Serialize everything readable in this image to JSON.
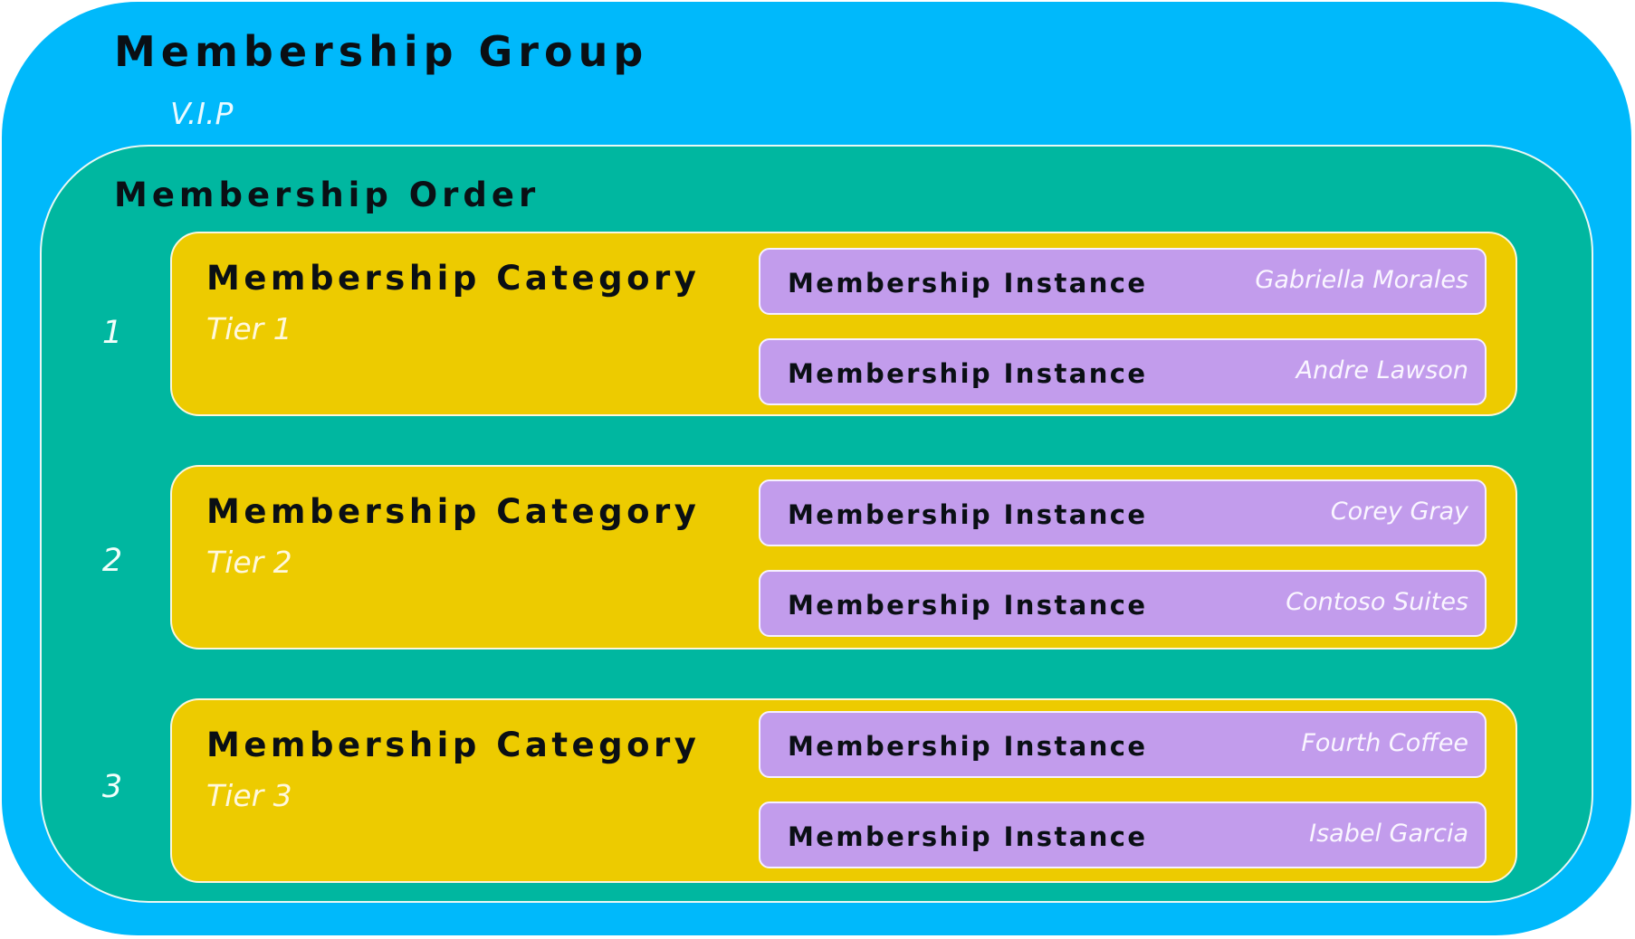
{
  "group": {
    "title": "Membership Group",
    "subtitle": "V.I.P"
  },
  "order": {
    "title": "Membership Order",
    "categories": [
      {
        "number": "1",
        "title": "Membership Category",
        "tier": "Tier 1",
        "instances": [
          {
            "title": "Membership Instance",
            "name": "Gabriella Morales"
          },
          {
            "title": "Membership Instance",
            "name": "Andre Lawson"
          }
        ]
      },
      {
        "number": "2",
        "title": "Membership Category",
        "tier": "Tier 2",
        "instances": [
          {
            "title": "Membership Instance",
            "name": "Corey Gray"
          },
          {
            "title": "Membership Instance",
            "name": "Contoso Suites"
          }
        ]
      },
      {
        "number": "3",
        "title": "Membership Category",
        "tier": "Tier 3",
        "instances": [
          {
            "title": "Membership Instance",
            "name": "Fourth Coffee"
          },
          {
            "title": "Membership Instance",
            "name": "Isabel Garcia"
          }
        ]
      }
    ]
  },
  "colors": {
    "group": "#00b9fb",
    "order": "#00b7a0",
    "category": "#edcb00",
    "instance": "#c29cec"
  }
}
